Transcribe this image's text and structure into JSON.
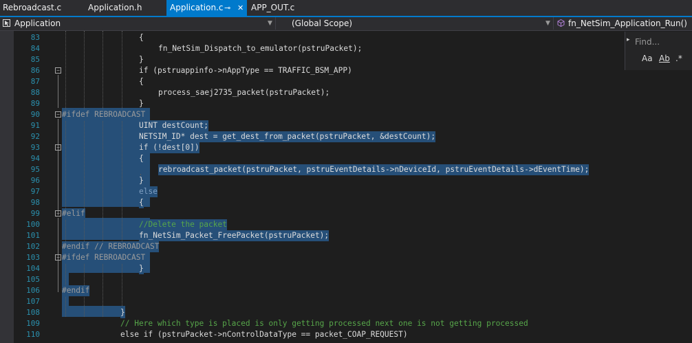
{
  "tabs": [
    {
      "label": "Rebroadcast.c",
      "active": false
    },
    {
      "label": "Application.h",
      "active": false
    },
    {
      "label": "Application.c",
      "active": true
    },
    {
      "label": "APP_OUT.c",
      "active": false
    }
  ],
  "tab_pin_glyph": "⊸",
  "tab_close_glyph": "✕",
  "navbar": {
    "project": "Application",
    "scope": "(Global Scope)",
    "function": "fn_NetSim_Application_Run()"
  },
  "find": {
    "placeholder": "Find...",
    "match_case": "Aa",
    "whole_word": "Ab",
    "regex": ".*"
  },
  "lines": [
    {
      "n": "83",
      "text": "{"
    },
    {
      "n": "84",
      "text": "fn_NetSim_Dispatch_to_emulator(pstruPacket);"
    },
    {
      "n": "85",
      "text": "}"
    },
    {
      "n": "86",
      "text": "if (pstruappinfo->nAppType == TRAFFIC_BSM_APP)"
    },
    {
      "n": "87",
      "text": "{"
    },
    {
      "n": "88",
      "text": "process_saej2735_packet(pstruPacket);"
    },
    {
      "n": "89",
      "text": "}"
    },
    {
      "n": "90",
      "text": "#ifdef REBROADCAST"
    },
    {
      "n": "91",
      "text": "UINT destCount;"
    },
    {
      "n": "92",
      "text": "NETSIM_ID* dest = get_dest_from_packet(pstruPacket, &destCount);"
    },
    {
      "n": "93",
      "text": "if (!dest[0])"
    },
    {
      "n": "94",
      "text": "{"
    },
    {
      "n": "95",
      "text": "rebroadcast_packet(pstruPacket, pstruEventDetails->nDeviceId, pstruEventDetails->dEventTime);"
    },
    {
      "n": "96",
      "text": "}"
    },
    {
      "n": "97",
      "text": "else"
    },
    {
      "n": "98",
      "text": "{"
    },
    {
      "n": "99",
      "text": "#elif"
    },
    {
      "n": "100",
      "text": "//Delete the packet"
    },
    {
      "n": "101",
      "text": "fn_NetSim_Packet_FreePacket(pstruPacket);"
    },
    {
      "n": "102",
      "text": "#endif // REBROADCAST"
    },
    {
      "n": "103",
      "text": "#ifdef REBROADCAST"
    },
    {
      "n": "104",
      "text": "}"
    },
    {
      "n": "105",
      "text": ""
    },
    {
      "n": "106",
      "text": "#endif"
    },
    {
      "n": "107",
      "text": ""
    },
    {
      "n": "108",
      "text": "}"
    },
    {
      "n": "109",
      "text": "// Here which type is placed is only getting processed next one is not getting processed"
    },
    {
      "n": "110",
      "text": "else if (pstruPacket->nControlDataType == packet_COAP_REQUEST)"
    }
  ],
  "colors": {
    "background": "#1e1e1e",
    "selection": "#264f78",
    "accent": "#007acc",
    "line_number": "#2b91af",
    "keyword": "#569cd6",
    "type": "#4ec9b0",
    "comment": "#57a64a",
    "macro": "#bd63c5"
  }
}
